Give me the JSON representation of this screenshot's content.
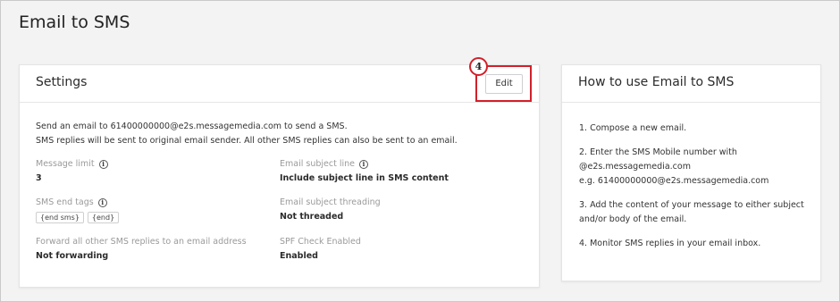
{
  "page": {
    "title": "Email to SMS"
  },
  "settings": {
    "title": "Settings",
    "edit_label": "Edit",
    "callout_number": "4",
    "intro_line1": "Send an email to 61400000000@e2s.messagemedia.com to send a SMS.",
    "intro_line2": "SMS replies will be sent to original email sender. All other SMS replies can also be sent to an email.",
    "message_limit": {
      "label": "Message limit",
      "value": "3"
    },
    "sms_end_tags": {
      "label": "SMS end tags",
      "tags": [
        "{end sms}",
        "{end}"
      ]
    },
    "forward": {
      "label": "Forward all other SMS replies to an email address",
      "value": "Not forwarding"
    },
    "subject_line": {
      "label": "Email subject line",
      "value": "Include subject line in SMS content"
    },
    "threading": {
      "label": "Email subject threading",
      "value": "Not threaded"
    },
    "spf": {
      "label": "SPF Check Enabled",
      "value": "Enabled"
    }
  },
  "howto": {
    "title": "How to use Email to SMS",
    "step1": "1. Compose a new email.",
    "step2_line1": "2. Enter the SMS Mobile number with",
    "step2_line2": "@e2s.messagemedia.com",
    "step2_line3": "e.g. 61400000000@e2s.messagemedia.com",
    "step3_line1": "3. Add the content of your message to either subject",
    "step3_line2": "and/or body of the email.",
    "step4": "4. Monitor SMS replies in your email inbox."
  },
  "colors": {
    "callout": "#d1202a",
    "label_grey": "#9a9a9a"
  }
}
